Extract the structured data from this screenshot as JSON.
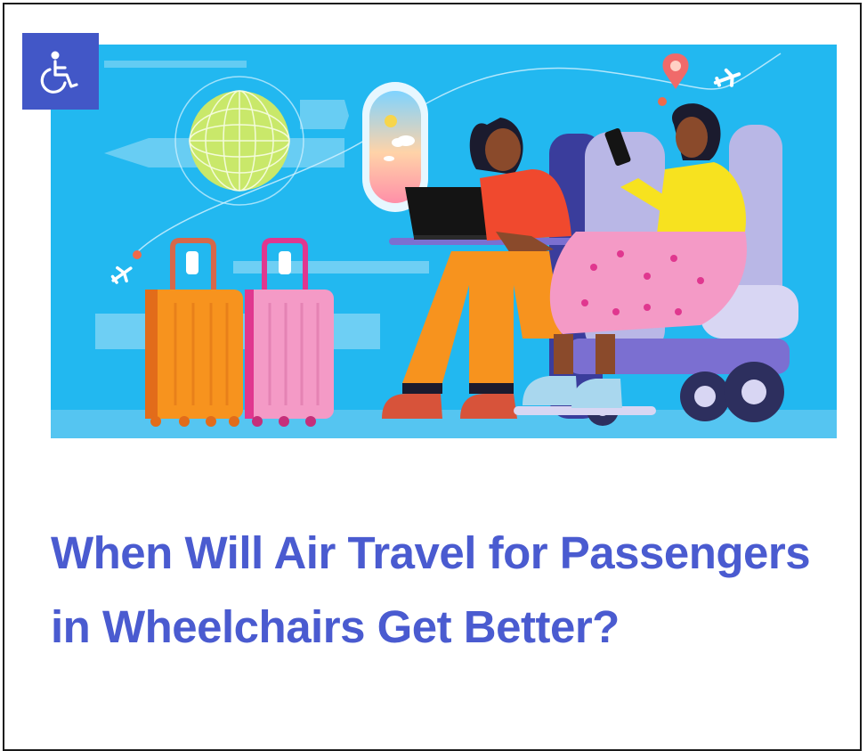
{
  "article": {
    "title": "When Will Air Travel for Passengers in Wheelchairs Get Better?",
    "category_badge_icon": "wheelchair-accessibility-icon"
  },
  "hero_image": {
    "scene": [
      "globe",
      "airplane-window",
      "luggage",
      "laptop",
      "passenger",
      "wheelchair-passenger",
      "airplane",
      "location-pin"
    ]
  },
  "colors": {
    "title": "#4a5bd0",
    "badge": "#4257c7",
    "hero_sky": "#22b8f0"
  }
}
